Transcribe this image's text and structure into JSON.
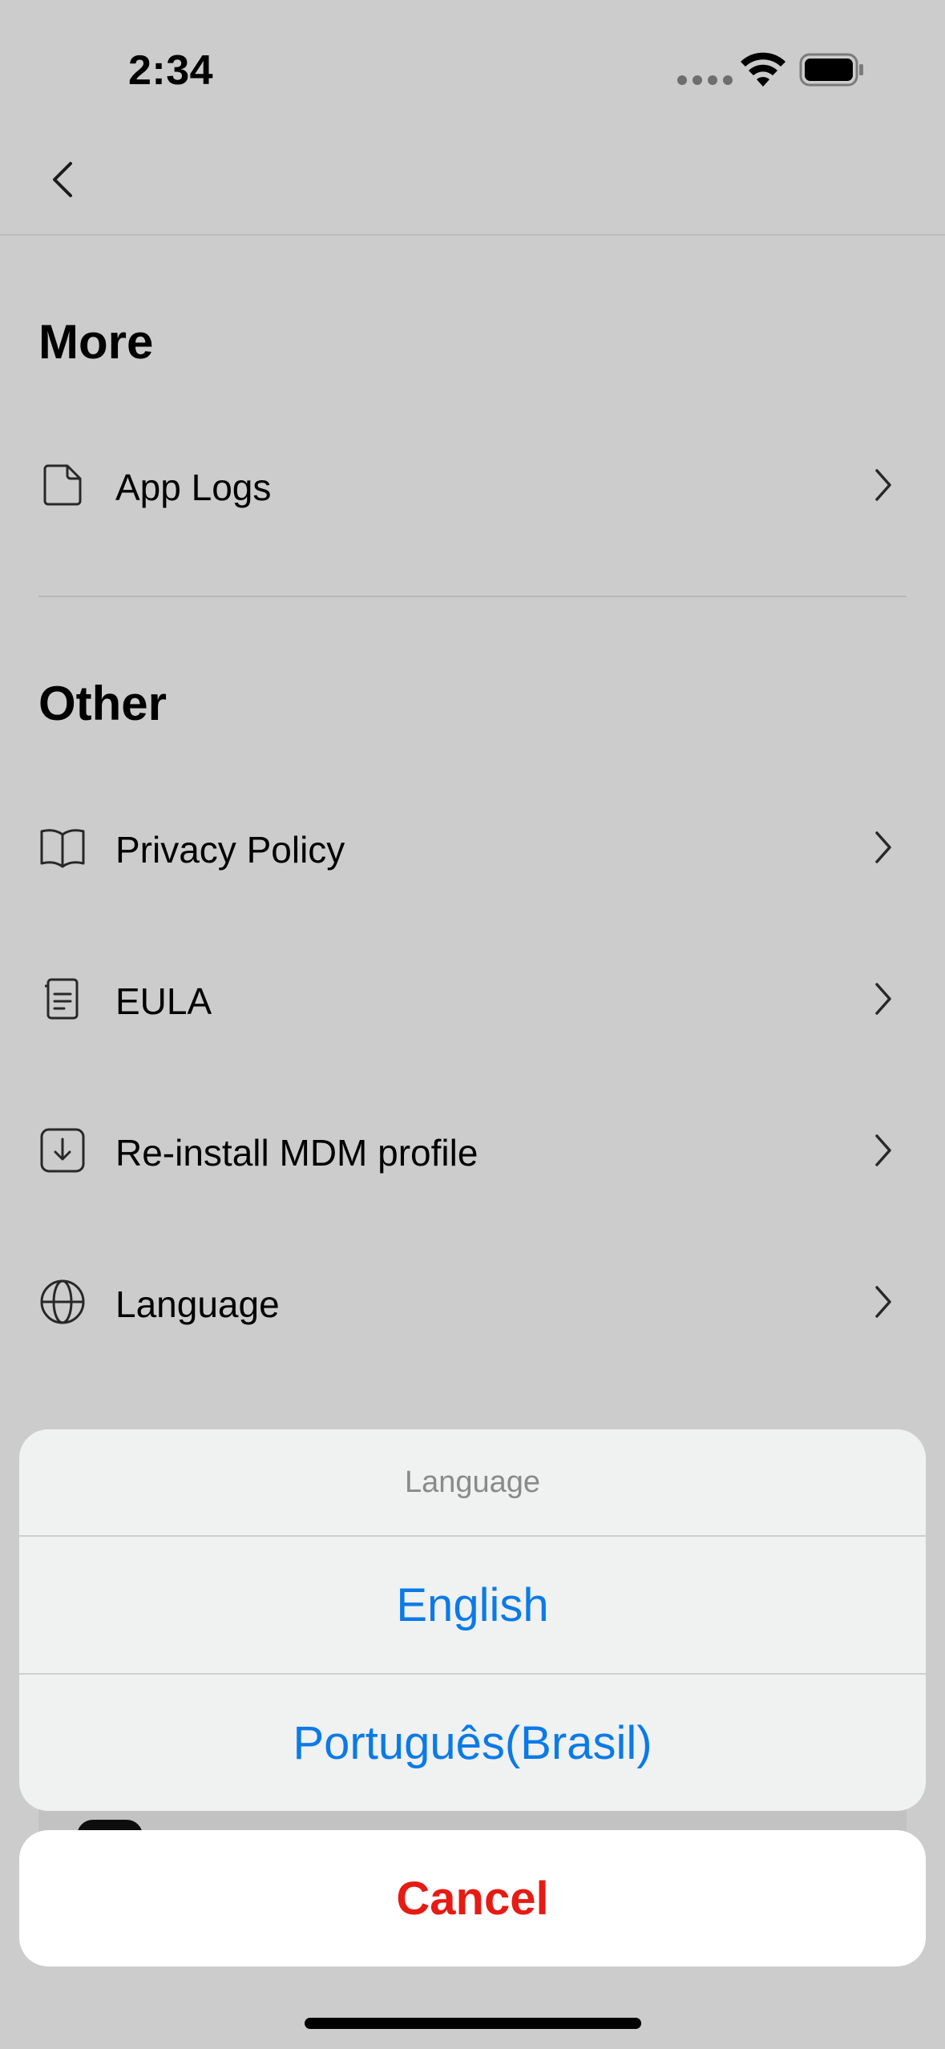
{
  "status_bar": {
    "time": "2:34",
    "icons": [
      "signal-dots-icon",
      "wifi-icon",
      "battery-icon"
    ]
  },
  "nav": {
    "back_icon": "chevron-left-icon"
  },
  "sections": [
    {
      "title": "More",
      "items": [
        {
          "label": "App Logs",
          "icon": "document-icon"
        }
      ]
    },
    {
      "title": "Other",
      "items": [
        {
          "label": "Privacy Policy",
          "icon": "book-icon"
        },
        {
          "label": "EULA",
          "icon": "receipt-icon"
        },
        {
          "label": "Re-install MDM profile",
          "icon": "download-icon"
        },
        {
          "label": "Language",
          "icon": "globe-icon"
        }
      ]
    }
  ],
  "action_sheet": {
    "title": "Language",
    "options": [
      {
        "label": "English"
      },
      {
        "label": "Português(Brasil)"
      }
    ],
    "cancel_label": "Cancel"
  },
  "colors": {
    "option_text": "#0a7ae8",
    "cancel_text": "#e61b14",
    "sheet_background": "#f0f1f1",
    "overlay": "rgba(0,0,0,0.2)"
  }
}
